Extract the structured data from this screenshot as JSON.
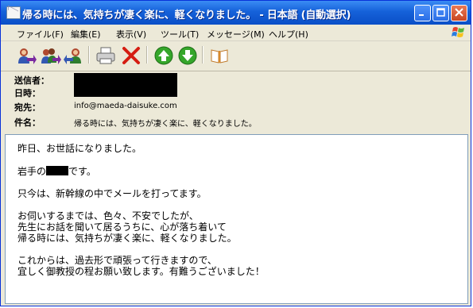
{
  "window": {
    "title": "帰る時には、気持ちが凄く楽に、軽くなりました。 - 日本語 (自動選択)"
  },
  "menu": {
    "file": "ファイル(F)",
    "edit": "編集(E)",
    "view": "表示(V)",
    "tools": "ツール(T)",
    "message": "メッセージ(M)",
    "help": "ヘルプ(H)"
  },
  "toolbar": {
    "icons": [
      "reply-icon",
      "reply-all-icon",
      "forward-icon",
      "print-icon",
      "delete-icon",
      "previous-icon",
      "next-icon",
      "address-book-icon"
    ]
  },
  "header": {
    "from_label": "送信者：",
    "date_label": "日時：",
    "to_label": "宛先：",
    "subject_label": "件名：",
    "to_value": "info@maeda-daisuke.com",
    "subject_value": "帰る時には、気持ちが凄く楽に、軽くなりました。"
  },
  "body": {
    "p1": "昨日、お世話になりました。",
    "p2_prefix": "岩手の",
    "p2_suffix": "です。",
    "p3": "只今は、新幹線の中でメールを打ってます。",
    "p4_line1": "お伺いするまでは、色々、不安でしたが、",
    "p4_line2": "先生にお話を聞いて居るうちに、心が落ち着いて",
    "p4_line3": "帰る時には、気持ちが凄く楽に、軽くなりました。",
    "p5_line1": "これからは、過去形で頑張って行きますので、",
    "p5_line2": "宜しく御教授の程お願い致します。有難うございました！"
  },
  "colors": {
    "titlebar": "#1561d9",
    "chrome": "#ece9d8",
    "close_button": "#c94722"
  }
}
